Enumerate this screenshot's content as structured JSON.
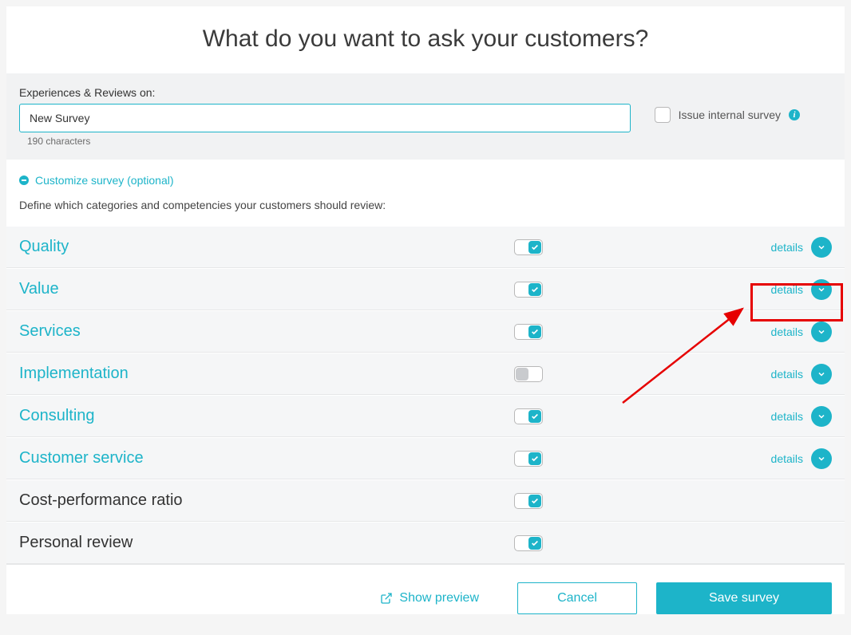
{
  "heading": "What do you want to ask your customers?",
  "form": {
    "label": "Experiences & Reviews on:",
    "survey_name": "New Survey",
    "char_count": "190 characters",
    "internal_label": "Issue internal survey"
  },
  "customize": {
    "link": "Customize survey (optional)",
    "description": "Define which categories and competencies your customers should review:"
  },
  "details_label": "details",
  "categories": [
    {
      "name": "Quality",
      "checked": true,
      "has_details": true,
      "title_link": true
    },
    {
      "name": "Value",
      "checked": true,
      "has_details": true,
      "title_link": true
    },
    {
      "name": "Services",
      "checked": true,
      "has_details": true,
      "title_link": true
    },
    {
      "name": "Implementation",
      "checked": false,
      "has_details": true,
      "title_link": true
    },
    {
      "name": "Consulting",
      "checked": true,
      "has_details": true,
      "title_link": true
    },
    {
      "name": "Customer service",
      "checked": true,
      "has_details": true,
      "title_link": true
    },
    {
      "name": "Cost-performance ratio",
      "checked": true,
      "has_details": false,
      "title_link": false
    },
    {
      "name": "Personal review",
      "checked": true,
      "has_details": false,
      "title_link": false
    }
  ],
  "footer": {
    "show_preview": "Show preview",
    "cancel": "Cancel",
    "save": "Save survey"
  }
}
